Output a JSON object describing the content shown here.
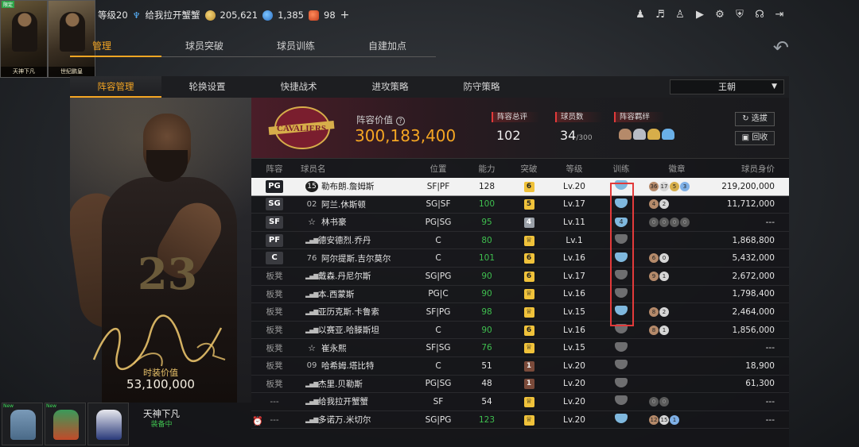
{
  "top_bar": {
    "card1_label": "天神下凡",
    "card1_tag": "限定",
    "card2_label": "世纪鹏皇",
    "level_label": "等级20",
    "nickname": "给我拉开蟹蟹",
    "gold": "205,621",
    "tickets": "1,385",
    "gems": "98",
    "plus": "+",
    "icons": [
      "user-icon",
      "bell-icon",
      "friends-icon",
      "video-icon",
      "gear-icon",
      "shield-add-icon",
      "headset-icon",
      "exit-icon"
    ]
  },
  "main_tabs": [
    "管理",
    "球员突破",
    "球员训练",
    "自建加点"
  ],
  "sub_tabs": [
    "阵容管理",
    "轮换设置",
    "快捷战术",
    "进攻策略",
    "防守策略"
  ],
  "team_select": "王朝",
  "hero": {
    "jersey": "23",
    "value_label": "时装价值",
    "value": "53,100,000"
  },
  "team": {
    "logo_text": "CAVALIERS",
    "lineup_value_label": "阵容价值",
    "lineup_value": "300,183,400",
    "overall_label": "阵容总评",
    "overall": "102",
    "count_label": "球员数",
    "count": "34",
    "count_max": "/300",
    "bond_label": "阵容羁绊",
    "btn_select": "选拔",
    "btn_recycle": "回收"
  },
  "table": {
    "headers": [
      "阵容",
      "球员名",
      "位置",
      "能力",
      "突破",
      "等级",
      "训练",
      "徽章",
      "球员身价"
    ],
    "rows": [
      {
        "pos": "PG",
        "no": "15",
        "name": "勒布朗.詹姆斯",
        "slot": "SF|PF",
        "ovr": "128",
        "brk": "6",
        "lv": "Lv.20",
        "train": "",
        "badges": [
          "36",
          "17",
          "5",
          "3"
        ],
        "salary": "219,200,000"
      },
      {
        "pos": "SG",
        "no": "02",
        "name": "阿兰.休斯顿",
        "slot": "SG|SF",
        "ovr": "100",
        "brk": "5",
        "lv": "Lv.17",
        "train": "",
        "badges": [
          "4",
          "2"
        ],
        "salary": "11,712,000"
      },
      {
        "pos": "SF",
        "no": "☆",
        "name": "林书豪",
        "slot": "PG|SG",
        "ovr": "95",
        "brk": "4",
        "lv": "Lv.11",
        "train": "4",
        "badges": [
          "0",
          "0",
          "0",
          "0"
        ],
        "salary": "---"
      },
      {
        "pos": "PF",
        "no": "",
        "name": "德安德烈.乔丹",
        "slot": "C",
        "ovr": "80",
        "brk": "",
        "lv": "Lv.1",
        "train": "",
        "badges": [],
        "salary": "1,868,800"
      },
      {
        "pos": "C",
        "no": "76",
        "name": "阿尔提斯.吉尔莫尔",
        "slot": "C",
        "ovr": "101",
        "brk": "6",
        "lv": "Lv.16",
        "train": "",
        "badges": [
          "6",
          "0"
        ],
        "salary": "5,432,000"
      },
      {
        "pos": "板凳",
        "no": "",
        "name": "戴森.丹尼尔斯",
        "slot": "SG|PG",
        "ovr": "90",
        "brk": "6",
        "lv": "Lv.17",
        "train": "",
        "badges": [
          "9",
          "1"
        ],
        "salary": "2,672,000"
      },
      {
        "pos": "板凳",
        "no": "",
        "name": "本.西蒙斯",
        "slot": "PG|C",
        "ovr": "90",
        "brk": "",
        "lv": "Lv.16",
        "train": "",
        "badges": [],
        "salary": "1,798,400"
      },
      {
        "pos": "板凳",
        "no": "",
        "name": "亚历克斯.卡鲁索",
        "slot": "SF|PG",
        "ovr": "98",
        "brk": "",
        "lv": "Lv.15",
        "train": "",
        "badges": [
          "8",
          "2"
        ],
        "salary": "2,464,000"
      },
      {
        "pos": "板凳",
        "no": "",
        "name": "以赛亚.哈滕斯坦",
        "slot": "C",
        "ovr": "90",
        "brk": "6",
        "lv": "Lv.16",
        "train": "",
        "badges": [
          "8",
          "1"
        ],
        "salary": "1,856,000"
      },
      {
        "pos": "板凳",
        "no": "☆",
        "name": "崔永熙",
        "slot": "SF|SG",
        "ovr": "76",
        "brk": "",
        "lv": "Lv.15",
        "train": "",
        "badges": [],
        "salary": "---"
      },
      {
        "pos": "板凳",
        "no": "09",
        "name": "哈希姆.塔比特",
        "slot": "C",
        "ovr": "51",
        "brk": "1",
        "lv": "Lv.20",
        "train": "",
        "badges": [],
        "salary": "18,900"
      },
      {
        "pos": "板凳",
        "no": "",
        "name": "杰里.贝勒斯",
        "slot": "PG|SG",
        "ovr": "48",
        "brk": "1",
        "lv": "Lv.20",
        "train": "",
        "badges": [],
        "salary": "61,300"
      },
      {
        "pos": "---",
        "no": "",
        "name": "给我拉开蟹蟹",
        "slot": "SF",
        "ovr": "54",
        "brk": "",
        "lv": "Lv.20",
        "train": "",
        "badges": [
          "0",
          "0"
        ],
        "salary": "---"
      },
      {
        "pos": "---",
        "no": "",
        "name": "多诺万.米切尔",
        "slot": "SG|PG",
        "ovr": "123",
        "brk": "",
        "lv": "Lv.20",
        "train": "",
        "badges": [
          "12",
          "15",
          "1"
        ],
        "salary": "---"
      }
    ]
  },
  "bottom": {
    "outfit_tags": [
      "New",
      "New",
      ""
    ],
    "player_name": "天神下凡",
    "player_status": "装备中"
  },
  "colors": {
    "accent": "#f5a623",
    "green": "#3fbf4f",
    "highlight_red": "#e23a3a"
  }
}
